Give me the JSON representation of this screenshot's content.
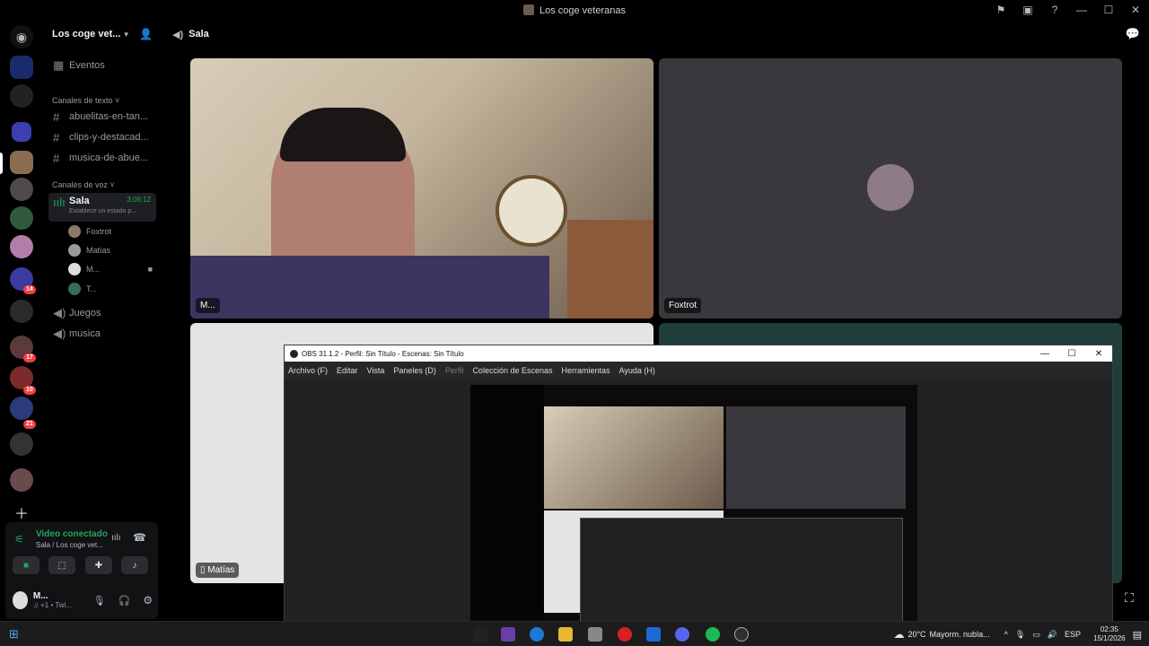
{
  "window": {
    "title": "Los coge veteranas"
  },
  "rail": {
    "badges": [
      "14",
      "17",
      "10",
      "21"
    ]
  },
  "server": {
    "name": "Los coge vet..."
  },
  "sidebar": {
    "events": "Eventos",
    "text_category": "Canales de texto",
    "text_channels": [
      "abuelitas-en-tan...",
      "clips-y-destacad...",
      "musica-de-abue..."
    ],
    "voice_category": "Canales de voz",
    "active_voice": {
      "name": "Sala",
      "timer": "3:06:12",
      "status": "Establece un estado p..."
    },
    "voice_users": [
      "Foxtrot",
      "Matías",
      "M...",
      "T..."
    ],
    "other_voice": [
      "Juegos",
      "musica"
    ]
  },
  "voice_panel": {
    "status": "Video conectado",
    "location": "Sala / Los coge vet...",
    "user_name": "M...",
    "user_status": "♫ +1 • Twi..."
  },
  "main": {
    "channel": "Sala",
    "tiles": [
      {
        "label": "M..."
      },
      {
        "label": "Foxtrot"
      },
      {
        "label": "Matías"
      }
    ]
  },
  "obs": {
    "title": "OBS 31.1.2 - Perfil: Sin Título - Escenas: Sin Título",
    "menu": [
      "Archivo (F)",
      "Editar",
      "Vista",
      "Paneles (D)",
      "Perfil",
      "Colección de Escenas",
      "Herramientas",
      "Ayuda (H)"
    ]
  },
  "taskbar": {
    "weather": "20°C",
    "weather_text": "Mayorm. nubla...",
    "lang": "ESP",
    "time": "02:35",
    "date": "15/1/2026"
  }
}
